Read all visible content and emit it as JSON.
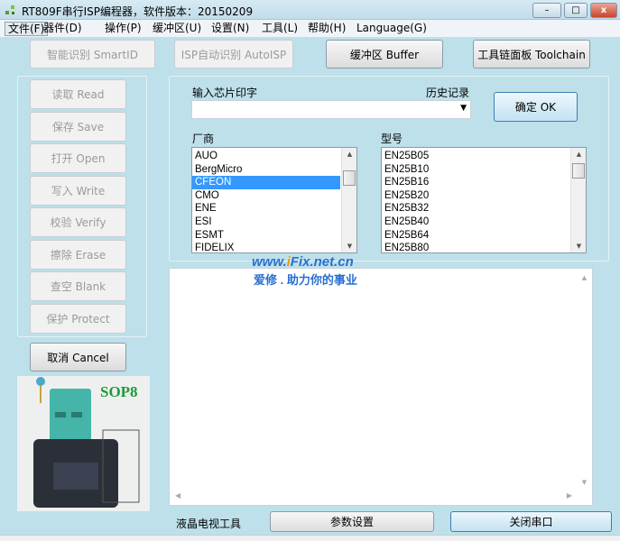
{
  "window": {
    "title": "RT809F串行ISP编程器，软件版本：20150209",
    "min": "–",
    "max": "□",
    "close": "x"
  },
  "menu": [
    {
      "label": "文件(F)"
    },
    {
      "label": "器件(D)"
    },
    {
      "label": "操作(P)"
    },
    {
      "label": "缓冲区(U)"
    },
    {
      "label": "设置(N)"
    },
    {
      "label": "工具(L)"
    },
    {
      "label": "帮助(H)"
    },
    {
      "label": "Language(G)"
    }
  ],
  "toolbar": {
    "smartid": "智能识别 SmartID",
    "autoisp": "ISP自动识别 AutoISP",
    "buffer": "缓冲区 Buffer",
    "toolchain": "工具链面板 Toolchain"
  },
  "ops": [
    {
      "label": "读取 Read"
    },
    {
      "label": "保存 Save"
    },
    {
      "label": "打开 Open"
    },
    {
      "label": "写入 Write"
    },
    {
      "label": "校验 Verify"
    },
    {
      "label": "擦除 Erase"
    },
    {
      "label": "查空 Blank"
    },
    {
      "label": "保护 Protect"
    }
  ],
  "cancel": "取消 Cancel",
  "socket": {
    "label": "SOP8"
  },
  "chip": {
    "input_label": "输入芯片印字",
    "history_label": "历史记录",
    "input_value": "",
    "ok": "确定 OK",
    "vendor_label": "厂商",
    "model_label": "型号",
    "vendors": [
      "AUO",
      "BergMicro",
      "CFEON",
      "CMO",
      "ENE",
      "ESI",
      "ESMT",
      "FIDELIX"
    ],
    "selected_vendor": "CFEON",
    "models": [
      "EN25B05",
      "EN25B10",
      "EN25B16",
      "EN25B20",
      "EN25B32",
      "EN25B40",
      "EN25B64",
      "EN25B80"
    ]
  },
  "watermark": {
    "line1_pre": "www.",
    "line1_i": "i",
    "line1_post": "Fix.net.cn",
    "line2": "爱修 . 助力你的事业"
  },
  "bottom": {
    "lcd_tools": "液晶电视工具",
    "params": "参数设置",
    "close_port": "关闭串口"
  },
  "colors": {
    "selection": "#3399ff",
    "background": "#bde0ea",
    "watermark": "#2a6fd0"
  }
}
